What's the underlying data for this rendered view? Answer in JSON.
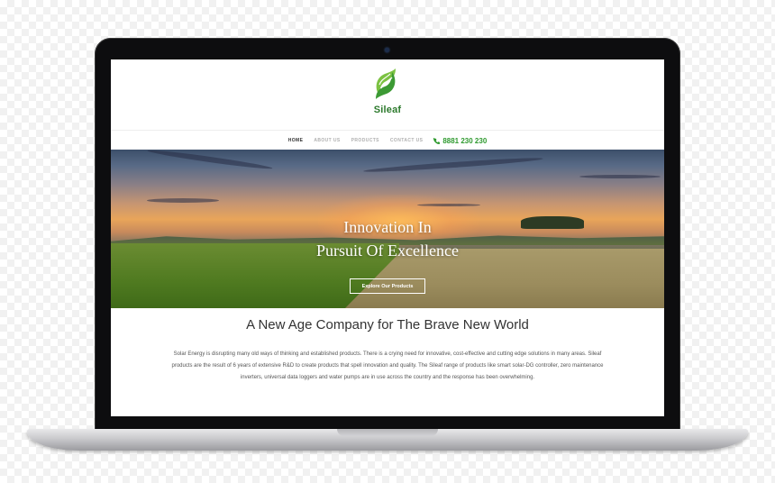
{
  "site": {
    "brand": "Sileaf",
    "brand_color": "#2d7a2d",
    "accent_color": "#2f9a2f",
    "logo_icon": "leaf-swirl-logo"
  },
  "nav": {
    "items": [
      {
        "label": "HOME",
        "active": true
      },
      {
        "label": "ABOUT US",
        "active": false
      },
      {
        "label": "PRODUCTS",
        "active": false
      },
      {
        "label": "CONTACT US",
        "active": false
      }
    ],
    "phone": "8881 230 230",
    "phone_icon": "phone-icon"
  },
  "hero": {
    "title_line1": "Innovation In",
    "title_line2": "Pursuit Of Excellence",
    "button_label": "Explore Our Products"
  },
  "intro": {
    "title": "A New Age Company for The Brave New World",
    "body": "Solar Energy is disrupting many old ways of thinking and established products. There is a crying need for innovative, cost-effective and cutting edge solutions in many areas. Sileaf products are the result of 6 years of extensive R&D to create products that spell innovation and quality. The Sileaf range of products like smart solar-DG controller, zero maintenance inverters, universal data loggers and water pumps are in use across the country and the response has been overwhelming."
  }
}
